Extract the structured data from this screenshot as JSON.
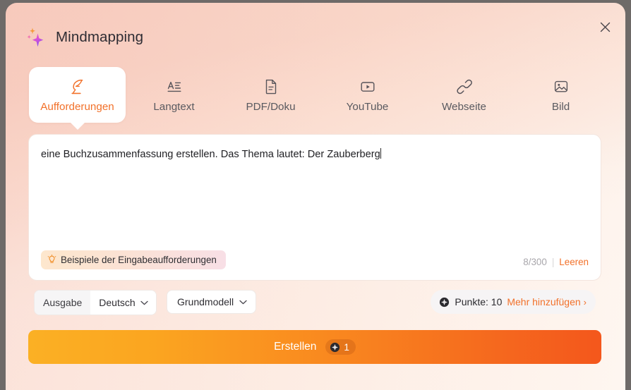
{
  "header": {
    "title": "Mindmapping",
    "sparkle_icon": "sparkle-icon",
    "close_icon": "close-icon"
  },
  "tabs": [
    {
      "label": "Aufforderungen",
      "icon": "feather-quill-icon",
      "active": true
    },
    {
      "label": "Langtext",
      "icon": "text-format-icon",
      "active": false
    },
    {
      "label": "PDF/Doku",
      "icon": "document-icon",
      "active": false
    },
    {
      "label": "YouTube",
      "icon": "youtube-play-icon",
      "active": false
    },
    {
      "label": "Webseite",
      "icon": "link-chain-icon",
      "active": false
    },
    {
      "label": "Bild",
      "icon": "image-icon",
      "active": false
    }
  ],
  "prompt": {
    "value": "eine Buchzusammenfassung erstellen. Das Thema lautet: Der Zauberberg",
    "placeholder": "eine Buchzusammenfassung erstellen. Das Thema lautet: Der Zauberberg",
    "examples_chip": "Beispiele der Eingabeaufforderungen",
    "examples_icon": "lightbulb-icon",
    "char_count": "8/300",
    "divider": "|",
    "clear_label": "Leeren"
  },
  "options": {
    "output_label": "Ausgabe",
    "language_value": "Deutsch",
    "model_value": "Grundmodell",
    "points_label": "Punkte: 10",
    "points_icon": "coin-icon",
    "add_more_label": "Mehr hinzufügen",
    "add_more_chevron": "›"
  },
  "create": {
    "label": "Erstellen",
    "cost": "1",
    "cost_icon": "coin-icon"
  },
  "colors": {
    "accent_orange": "#f2712a",
    "button_gradient_start": "#fbb024",
    "button_gradient_end": "#f4571c",
    "background_pink": "#fbe3dc",
    "text_dark": "#2e2c33",
    "muted_gray": "#a8a6ab"
  }
}
